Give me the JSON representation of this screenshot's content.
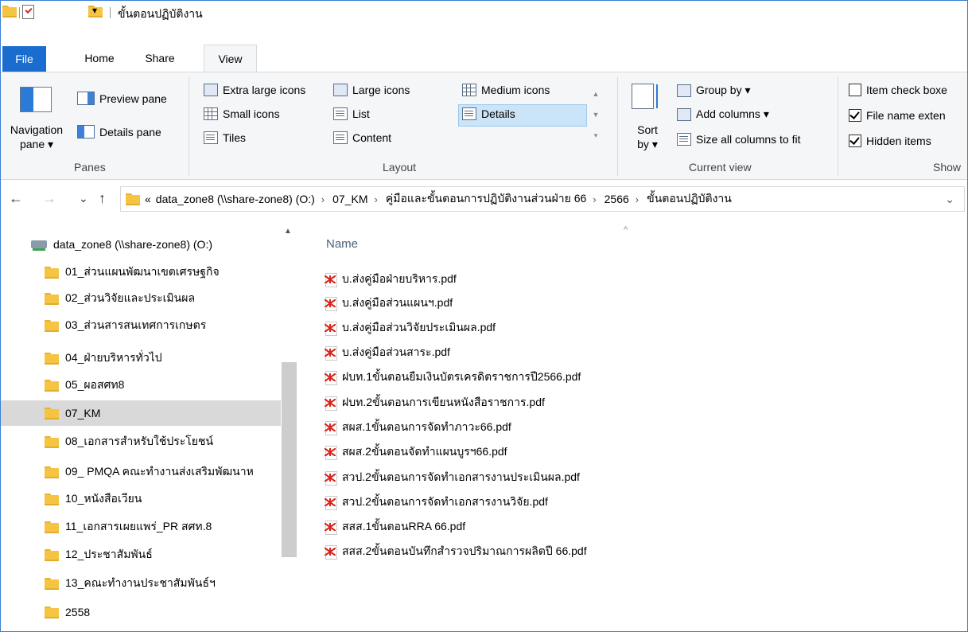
{
  "window": {
    "title": "ขั้นตอนปฏิบัติงาน",
    "qat_dropdown": "▾"
  },
  "ribbon": {
    "tabs": [
      "File",
      "Home",
      "Share",
      "View"
    ],
    "active_tab": "View",
    "panes": {
      "navigation_pane": "Navigation pane ▾",
      "preview_pane": "Preview pane",
      "details_pane": "Details pane",
      "group_label": "Panes"
    },
    "layout": {
      "extra_large_icons": "Extra large icons",
      "large_icons": "Large icons",
      "medium_icons": "Medium icons",
      "small_icons": "Small icons",
      "list": "List",
      "details": "Details",
      "tiles": "Tiles",
      "content": "Content",
      "group_label": "Layout",
      "selected": "Details"
    },
    "current_view": {
      "sort_by": "Sort by ▾",
      "group_by": "Group by ▾",
      "add_columns": "Add columns ▾",
      "size_all_columns": "Size all columns to fit",
      "group_label": "Current view"
    },
    "show_hide": {
      "item_check_boxes": "Item check boxe",
      "file_name_extensions": "File name exten",
      "hidden_items": "Hidden items",
      "group_label": "Show",
      "item_check_boxes_checked": false,
      "file_name_extensions_checked": true,
      "hidden_items_checked": true
    }
  },
  "address": {
    "overflow": "«",
    "crumbs": [
      "data_zone8 (\\\\share-zone8) (O:)",
      "07_KM",
      "คู่มือและขั้นตอนการปฏิบัติงานส่วนฝ่าย 66",
      "2566",
      "ขั้นตอนปฏิบัติงาน"
    ]
  },
  "nav_tree": {
    "drive": "data_zone8 (\\\\share-zone8) (O:)",
    "folders": [
      "01_ส่วนแผนพัฒนาเขตเศรษฐกิจ",
      "02_ส่วนวิจัยและประเมินผล",
      "03_ส่วนสารสนเทศการเกษตร",
      "04_ฝ่ายบริหารทั่วไป",
      "05_ผอสศท8",
      "07_KM",
      "08_เอกสารสำหรับใช้ประโยชน์",
      "09_ PMQA คณะทำงานส่งเสริมพัฒนาห",
      "10_หนังสือเวียน",
      "11_เอกสารเผยแพร่_PR สศท.8",
      "12_ประชาสัมพันธ์",
      "13_คณะทำงานประชาสัมพันธ์ฯ",
      "2558"
    ],
    "selected": "07_KM"
  },
  "file_list": {
    "column_name": "Name",
    "files": [
      "บ.ส่งคู่มือฝ่ายบริหาร.pdf",
      "บ.ส่งคู่มือส่วนแผนฯ.pdf",
      "บ.ส่งคู่มือส่วนวิจัยประเมินผล.pdf",
      "บ.ส่งคู่มือส่วนสาระ.pdf",
      "ฝบท.1ขั้นตอนยืมเงินบัตรเครดิตราชการปี2566.pdf",
      "ฝบท.2ขั้นตอนการเขียนหนังสือราชการ.pdf",
      "สผส.1ขั้นตอนการจัดทำภาวะ66.pdf",
      "สผส.2ขั้นตอนจัดทำแผนบูรฯ66.pdf",
      "สวป.2ขั้นตอนการจัดทำเอกสารงานประเมินผล.pdf",
      "สวป.2ขั้นตอนการจัดทำเอกสารงานวิจัย.pdf",
      "สสส.1ขั้นตอนRRA 66.pdf",
      "สสส.2ขั้นตอนบันทึกสำรวจปริมาณการผลิตปี 66.pdf"
    ]
  },
  "colors": {
    "accent": "#1a6ccf",
    "selected_layout": "#cce4f7",
    "tree_selected": "#d9d9d9",
    "folder": "#f5c542",
    "pdf": "#d9261c"
  },
  "icons": {
    "folder": "folder-icon",
    "pdf": "pdf-icon",
    "drive": "network-drive-icon",
    "back": "←",
    "forward": "→",
    "recent": "⌄",
    "up": "↑",
    "address_chevron": "›",
    "address_dropdown": "⌄",
    "scroll_up": "▲",
    "sort_caret": "^"
  }
}
